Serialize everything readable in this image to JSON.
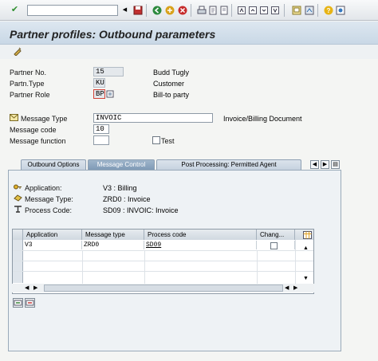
{
  "window": {
    "title": "Partner profiles: Outbound parameters"
  },
  "toolbar": {
    "enter_icon": "✔",
    "command_value": "",
    "dropdown_icon": "◀"
  },
  "header": {
    "partner_no": {
      "label": "Partner No.",
      "value": "15",
      "description": "Budd Tugly"
    },
    "partn_type": {
      "label": "Partn.Type",
      "value": "KU",
      "description": "Customer"
    },
    "partner_role": {
      "label": "Partner Role",
      "value": "BP",
      "description": "Bill-to party"
    }
  },
  "message": {
    "type": {
      "label": "Message Type",
      "value": "INVOIC",
      "description": "Invoice/Billing Document"
    },
    "code": {
      "label": "Message code",
      "value": "10"
    },
    "function": {
      "label": "Message function",
      "value": ""
    },
    "test": {
      "label": "Test",
      "checked": false
    }
  },
  "tabs": [
    {
      "label": "Outbound Options",
      "active": false
    },
    {
      "label": "Message Control",
      "active": true
    },
    {
      "label": "Post Processing: Permitted Agent",
      "active": false
    }
  ],
  "details": {
    "application": {
      "label": "Application:",
      "value": "V3 : Billing"
    },
    "message_type": {
      "label": "Message Type:",
      "value": "ZRD0 : Invoice"
    },
    "process_code": {
      "label": "Process Code:",
      "value": "SD09 : INVOIC: Invoice"
    }
  },
  "table": {
    "columns": [
      "Application",
      "Message type",
      "Process code",
      "Chang..."
    ],
    "rows": [
      {
        "application": "V3",
        "message_type": "ZRD0",
        "process_code": "SD09",
        "change": false
      }
    ]
  },
  "colors": {
    "title_bg": "#c9d8e6",
    "active_tab": "#7f9ab6"
  }
}
